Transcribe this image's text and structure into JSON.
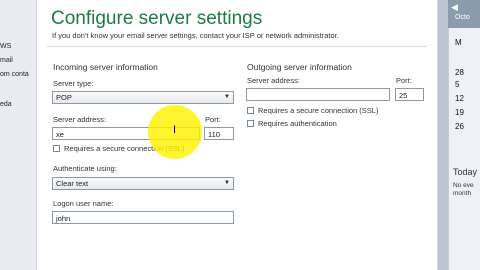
{
  "dialog": {
    "title": "Configure server settings",
    "subtitle": "If you don't know your email server settings, contact your ISP or network administrator."
  },
  "incoming": {
    "section_title": "Incoming server information",
    "server_type_label": "Server type:",
    "server_type_value": "POP",
    "server_address_label": "Server address:",
    "server_address_value": "xe",
    "port_label": "Port:",
    "port_value": "110",
    "ssl_label": "Requires a secure connection (SSL)",
    "auth_label": "Authenticate using:",
    "auth_value": "Clear text",
    "logon_label": "Logon user name:",
    "logon_value": "john"
  },
  "outgoing": {
    "section_title": "Outgoing server information",
    "server_address_label": "Server address:",
    "server_address_value": "",
    "port_label": "Port:",
    "port_value": "25",
    "ssl_label": "Requires a secure connection (SSL)",
    "auth_required_label": "Requires authentication"
  },
  "left_strip": {
    "items": [
      "WS",
      "mail",
      "om conta",
      "eda"
    ]
  },
  "calendar": {
    "header": "Octo",
    "weekday": "M",
    "days": [
      "28",
      "5",
      "12",
      "19",
      "26"
    ],
    "days2": [
      "29",
      "6",
      "13",
      "20"
    ],
    "today_label": "Today",
    "today_text_1": "No eve",
    "today_text_2": "month"
  },
  "colors": {
    "title_green": "#1e7b46",
    "highlight_yellow": "#fff200"
  }
}
